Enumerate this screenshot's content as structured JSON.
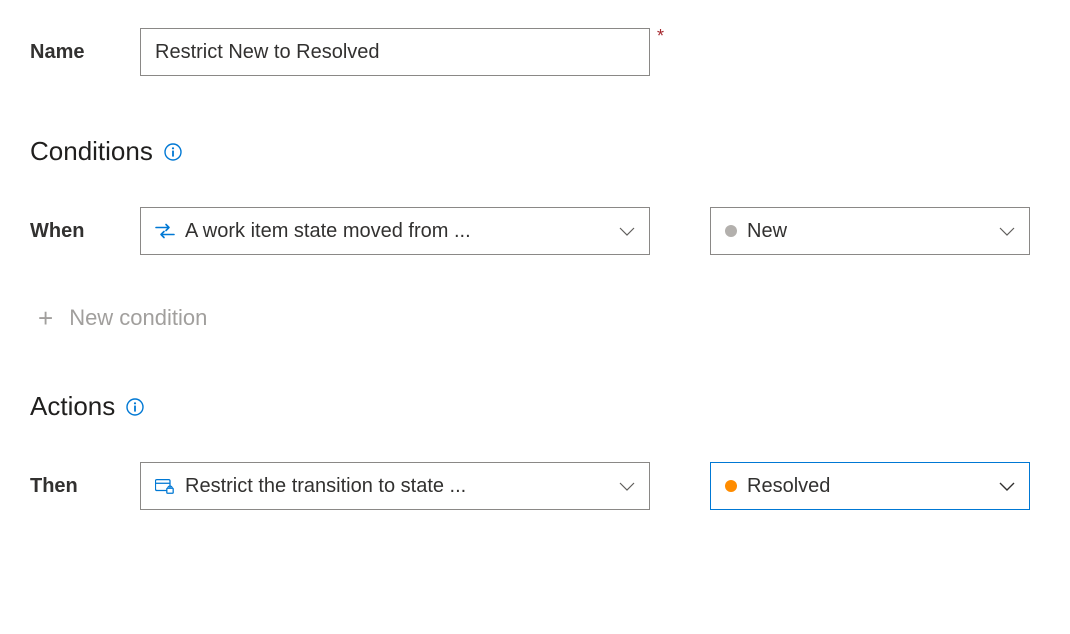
{
  "name": {
    "label": "Name",
    "value": "Restrict New to Resolved",
    "required_mark": "*"
  },
  "conditions": {
    "heading": "Conditions",
    "when_label": "When",
    "condition_type": "A work item state moved from ...",
    "state_value": "New",
    "state_color": "#b3b0ad",
    "add_condition_label": "New condition"
  },
  "actions": {
    "heading": "Actions",
    "then_label": "Then",
    "action_type": "Restrict the transition to state ...",
    "state_value": "Resolved",
    "state_color": "#ff8c00"
  },
  "icons": {
    "info": "info-icon",
    "arrows": "arrows-icon",
    "restrict": "restrict-lock-icon",
    "chevron": "chevron-down-icon",
    "plus": "plus-icon"
  }
}
